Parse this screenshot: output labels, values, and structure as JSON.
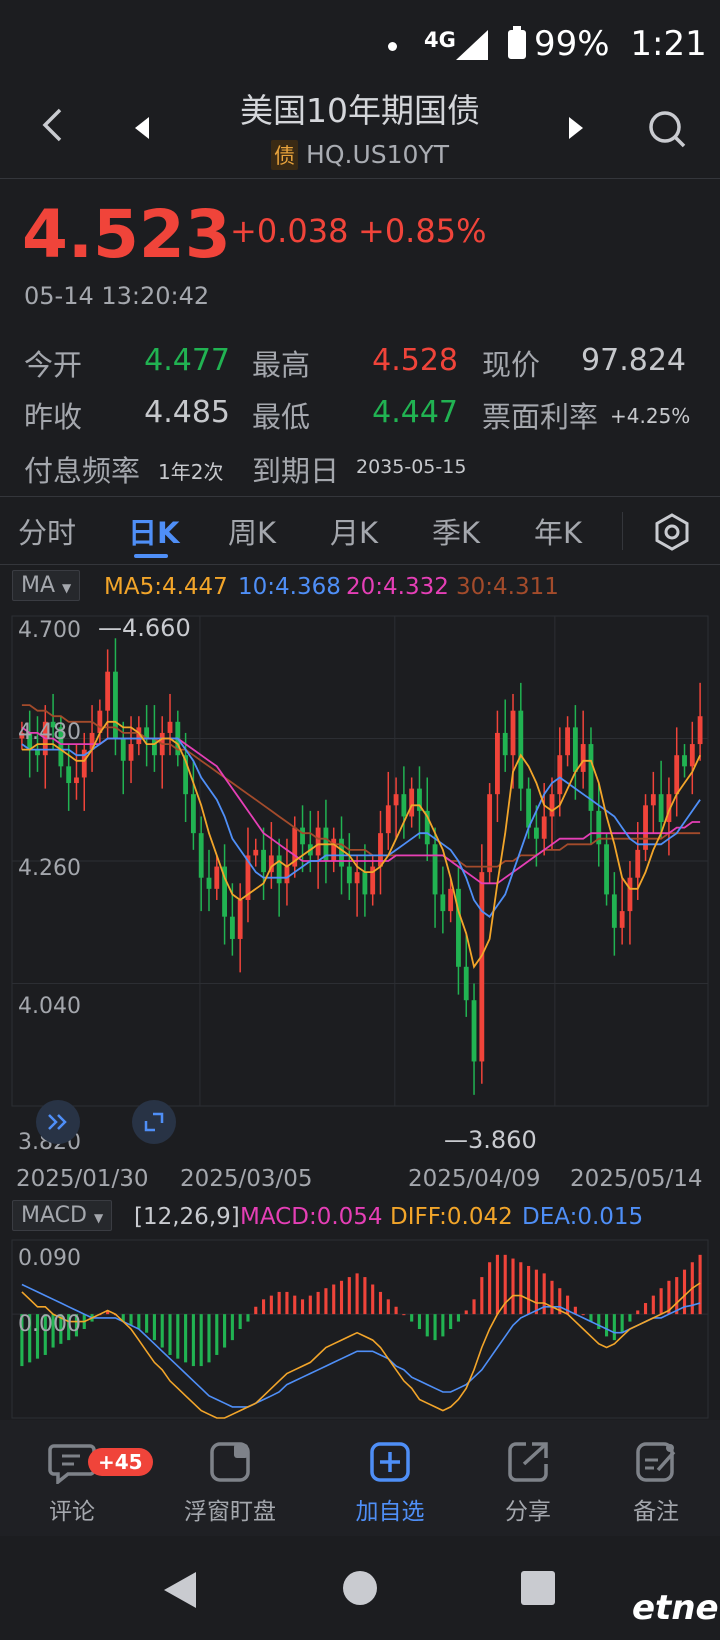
{
  "status_bar": {
    "network": "4G",
    "battery": "99%",
    "time": "1:21"
  },
  "header": {
    "title": "美国10年期国债",
    "badge": "债",
    "code": "HQ.US10YT"
  },
  "quote": {
    "price": "4.523",
    "change": "+0.038",
    "change_pct": "+0.85%",
    "timestamp": "05-14 13:20:42",
    "open_label": "今开",
    "open": "4.477",
    "high_label": "最高",
    "high": "4.528",
    "current_label": "现价",
    "current": "97.824",
    "prev_close_label": "昨收",
    "prev_close": "4.485",
    "low_label": "最低",
    "low": "4.447",
    "coupon_label": "票面利率",
    "coupon": "+4.25%",
    "freq_label": "付息频率",
    "freq": "1年2次",
    "maturity_label": "到期日",
    "maturity": "2035-05-15"
  },
  "tabs": [
    "分时",
    "日K",
    "周K",
    "月K",
    "季K",
    "年K"
  ],
  "active_tab": "日K",
  "ma_indicator": {
    "selector": "MA",
    "ma5": "MA5:4.447",
    "ma10": "10:4.368",
    "ma20": "20:4.332",
    "ma30": "30:4.311"
  },
  "macd_indicator": {
    "selector": "MACD",
    "params": "[12,26,9]",
    "macd": "MACD:0.054",
    "diff": "DIFF:0.042",
    "dea": "DEA:0.015"
  },
  "colors": {
    "up": "#f0443a",
    "down": "#21b352",
    "ma5": "#f2a52a",
    "ma10": "#4f8ff7",
    "ma20": "#e53fb6",
    "ma30": "#a34b2b",
    "accent": "#4f8ff7"
  },
  "chart_data": [
    {
      "type": "candlestick",
      "ylim": [
        3.82,
        4.7
      ],
      "y_ticks": [
        "4.700",
        "4.480",
        "4.260",
        "4.040",
        "3.820"
      ],
      "x_labels": [
        "2025/01/30",
        "2025/03/05",
        "2025/04/09",
        "2025/05/14"
      ],
      "max_label": "4.660",
      "min_label": "3.860",
      "close": [
        4.49,
        4.46,
        4.45,
        4.51,
        4.5,
        4.43,
        4.4,
        4.41,
        4.46,
        4.49,
        4.53,
        4.6,
        4.48,
        4.44,
        4.47,
        4.5,
        4.48,
        4.45,
        4.49,
        4.51,
        4.45,
        4.38,
        4.31,
        4.23,
        4.21,
        4.25,
        4.16,
        4.12,
        4.19,
        4.27,
        4.28,
        4.24,
        4.27,
        4.22,
        4.25,
        4.32,
        4.29,
        4.27,
        4.32,
        4.26,
        4.3,
        4.25,
        4.22,
        4.24,
        4.2,
        4.25,
        4.31,
        4.36,
        4.38,
        4.34,
        4.39,
        4.35,
        4.29,
        4.2,
        4.17,
        4.21,
        4.07,
        4.01,
        3.9,
        4.24,
        4.38,
        4.49,
        4.45,
        4.53,
        4.39,
        4.32,
        4.3,
        4.34,
        4.38,
        4.45,
        4.5,
        4.42,
        4.47,
        4.35,
        4.29,
        4.2,
        4.14,
        4.17,
        4.23,
        4.28,
        4.36,
        4.38,
        4.33,
        4.38,
        4.45,
        4.43,
        4.47,
        4.52
      ],
      "ma5": [
        4.46,
        4.46,
        4.47,
        4.47,
        4.47,
        4.46,
        4.45,
        4.44,
        4.44,
        4.46,
        4.49,
        4.51,
        4.51,
        4.5,
        4.5,
        4.49,
        4.47,
        4.47,
        4.48,
        4.48,
        4.47,
        4.44,
        4.4,
        4.36,
        4.31,
        4.27,
        4.23,
        4.2,
        4.19,
        4.2,
        4.21,
        4.22,
        4.25,
        4.26,
        4.25,
        4.26,
        4.27,
        4.28,
        4.29,
        4.29,
        4.29,
        4.28,
        4.27,
        4.25,
        4.24,
        4.24,
        4.25,
        4.27,
        4.3,
        4.33,
        4.36,
        4.36,
        4.34,
        4.31,
        4.28,
        4.23,
        4.17,
        4.13,
        4.07,
        4.09,
        4.12,
        4.22,
        4.31,
        4.42,
        4.45,
        4.43,
        4.4,
        4.36,
        4.35,
        4.36,
        4.39,
        4.42,
        4.44,
        4.44,
        4.4,
        4.34,
        4.29,
        4.23,
        4.21,
        4.21,
        4.24,
        4.28,
        4.31,
        4.35,
        4.38,
        4.4,
        4.42,
        4.45
      ],
      "ma10": [
        4.47,
        4.46,
        4.46,
        4.46,
        4.46,
        4.46,
        4.46,
        4.45,
        4.45,
        4.46,
        4.47,
        4.48,
        4.48,
        4.48,
        4.48,
        4.48,
        4.48,
        4.48,
        4.48,
        4.48,
        4.48,
        4.46,
        4.44,
        4.41,
        4.39,
        4.37,
        4.34,
        4.3,
        4.28,
        4.26,
        4.24,
        4.23,
        4.23,
        4.23,
        4.23,
        4.24,
        4.25,
        4.26,
        4.26,
        4.27,
        4.27,
        4.27,
        4.27,
        4.27,
        4.27,
        4.27,
        4.27,
        4.27,
        4.28,
        4.29,
        4.3,
        4.31,
        4.31,
        4.3,
        4.29,
        4.28,
        4.26,
        4.23,
        4.19,
        4.17,
        4.16,
        4.18,
        4.2,
        4.24,
        4.28,
        4.32,
        4.35,
        4.38,
        4.4,
        4.41,
        4.4,
        4.39,
        4.38,
        4.37,
        4.36,
        4.35,
        4.34,
        4.32,
        4.3,
        4.29,
        4.29,
        4.29,
        4.29,
        4.3,
        4.31,
        4.33,
        4.35,
        4.37
      ],
      "ma20": [
        4.5,
        4.49,
        4.49,
        4.48,
        4.48,
        4.47,
        4.47,
        4.47,
        4.47,
        4.47,
        4.47,
        4.48,
        4.48,
        4.48,
        4.48,
        4.48,
        4.48,
        4.48,
        4.48,
        4.48,
        4.48,
        4.47,
        4.46,
        4.45,
        4.44,
        4.43,
        4.41,
        4.39,
        4.37,
        4.35,
        4.33,
        4.31,
        4.3,
        4.29,
        4.28,
        4.27,
        4.26,
        4.26,
        4.26,
        4.26,
        4.26,
        4.26,
        4.26,
        4.26,
        4.26,
        4.26,
        4.26,
        4.26,
        4.27,
        4.27,
        4.27,
        4.27,
        4.27,
        4.27,
        4.27,
        4.26,
        4.25,
        4.24,
        4.23,
        4.22,
        4.22,
        4.22,
        4.23,
        4.24,
        4.25,
        4.26,
        4.27,
        4.28,
        4.29,
        4.3,
        4.3,
        4.3,
        4.3,
        4.31,
        4.31,
        4.31,
        4.31,
        4.31,
        4.31,
        4.31,
        4.31,
        4.31,
        4.31,
        4.31,
        4.32,
        4.32,
        4.33,
        4.33
      ],
      "ma30": [
        4.54,
        4.54,
        4.53,
        4.53,
        4.52,
        4.52,
        4.51,
        4.51,
        4.51,
        4.51,
        4.5,
        4.5,
        4.5,
        4.49,
        4.49,
        4.49,
        4.48,
        4.48,
        4.47,
        4.47,
        4.46,
        4.46,
        4.45,
        4.44,
        4.43,
        4.42,
        4.41,
        4.4,
        4.39,
        4.38,
        4.37,
        4.36,
        4.35,
        4.34,
        4.33,
        4.32,
        4.31,
        4.31,
        4.3,
        4.3,
        4.29,
        4.29,
        4.28,
        4.28,
        4.28,
        4.27,
        4.27,
        4.27,
        4.27,
        4.27,
        4.27,
        4.27,
        4.27,
        4.27,
        4.27,
        4.26,
        4.26,
        4.25,
        4.25,
        4.25,
        4.25,
        4.25,
        4.26,
        4.26,
        4.27,
        4.27,
        4.27,
        4.28,
        4.28,
        4.28,
        4.29,
        4.29,
        4.29,
        4.29,
        4.3,
        4.3,
        4.3,
        4.3,
        4.3,
        4.3,
        4.3,
        4.3,
        4.3,
        4.31,
        4.31,
        4.31,
        4.31,
        4.31
      ]
    },
    {
      "type": "bar",
      "ylim": [
        -0.14,
        0.1
      ],
      "y_ticks": [
        "0.090",
        "0.000"
      ],
      "macd_hist": [
        -0.07,
        -0.065,
        -0.06,
        -0.055,
        -0.045,
        -0.04,
        -0.035,
        -0.03,
        -0.02,
        -0.01,
        0,
        0.005,
        0,
        -0.01,
        -0.015,
        -0.02,
        -0.025,
        -0.035,
        -0.045,
        -0.055,
        -0.06,
        -0.065,
        -0.07,
        -0.07,
        -0.065,
        -0.055,
        -0.045,
        -0.035,
        -0.02,
        -0.01,
        0.01,
        0.02,
        0.025,
        0.03,
        0.03,
        0.025,
        0.02,
        0.025,
        0.03,
        0.035,
        0.04,
        0.045,
        0.05,
        0.055,
        0.05,
        0.04,
        0.03,
        0.02,
        0.01,
        0,
        -0.01,
        -0.02,
        -0.03,
        -0.035,
        -0.03,
        -0.02,
        -0.01,
        0.005,
        0.02,
        0.05,
        0.07,
        0.08,
        0.08,
        0.075,
        0.07,
        0.065,
        0.06,
        0.055,
        0.045,
        0.035,
        0.025,
        0.01,
        0,
        -0.01,
        -0.02,
        -0.03,
        -0.035,
        -0.025,
        -0.01,
        0.005,
        0.015,
        0.025,
        0.035,
        0.045,
        0.05,
        0.06,
        0.07,
        0.08
      ],
      "diff": [
        0.03,
        0.02,
        0.01,
        0.01,
        0.0,
        -0.005,
        -0.01,
        -0.01,
        -0.01,
        -0.005,
        0,
        0.005,
        0.0,
        -0.01,
        -0.02,
        -0.035,
        -0.05,
        -0.065,
        -0.075,
        -0.09,
        -0.1,
        -0.11,
        -0.12,
        -0.13,
        -0.135,
        -0.14,
        -0.14,
        -0.135,
        -0.13,
        -0.125,
        -0.12,
        -0.11,
        -0.1,
        -0.09,
        -0.08,
        -0.075,
        -0.07,
        -0.065,
        -0.055,
        -0.045,
        -0.04,
        -0.035,
        -0.03,
        -0.025,
        -0.03,
        -0.035,
        -0.045,
        -0.06,
        -0.075,
        -0.09,
        -0.1,
        -0.115,
        -0.12,
        -0.125,
        -0.13,
        -0.125,
        -0.115,
        -0.1,
        -0.075,
        -0.045,
        -0.02,
        0.0,
        0.015,
        0.025,
        0.025,
        0.02,
        0.015,
        0.015,
        0.01,
        0.005,
        0,
        -0.01,
        -0.02,
        -0.03,
        -0.04,
        -0.045,
        -0.04,
        -0.03,
        -0.02,
        -0.015,
        -0.01,
        -0.005,
        0,
        0.005,
        0.015,
        0.025,
        0.035,
        0.042
      ],
      "dea": [
        0.04,
        0.035,
        0.03,
        0.025,
        0.02,
        0.015,
        0.01,
        0.005,
        0,
        -0.005,
        -0.005,
        -0.005,
        -0.005,
        -0.01,
        -0.015,
        -0.02,
        -0.03,
        -0.04,
        -0.05,
        -0.06,
        -0.07,
        -0.08,
        -0.09,
        -0.1,
        -0.11,
        -0.115,
        -0.12,
        -0.125,
        -0.125,
        -0.125,
        -0.12,
        -0.115,
        -0.11,
        -0.105,
        -0.095,
        -0.09,
        -0.085,
        -0.08,
        -0.075,
        -0.07,
        -0.065,
        -0.06,
        -0.055,
        -0.05,
        -0.05,
        -0.05,
        -0.055,
        -0.06,
        -0.07,
        -0.075,
        -0.085,
        -0.09,
        -0.095,
        -0.1,
        -0.105,
        -0.105,
        -0.1,
        -0.095,
        -0.085,
        -0.075,
        -0.06,
        -0.045,
        -0.03,
        -0.015,
        -0.005,
        0,
        0.005,
        0.01,
        0.01,
        0.01,
        0.005,
        0.0,
        -0.005,
        -0.01,
        -0.015,
        -0.02,
        -0.025,
        -0.025,
        -0.02,
        -0.015,
        -0.01,
        -0.005,
        -0.005,
        0,
        0.005,
        0.01,
        0.012,
        0.015
      ]
    }
  ],
  "bottom_bar": {
    "items": [
      "评论",
      "浮窗盯盘",
      "加自选",
      "分享",
      "备注"
    ],
    "comment_badge": "+45",
    "active_item": "加自选"
  },
  "watermark": "etnet"
}
